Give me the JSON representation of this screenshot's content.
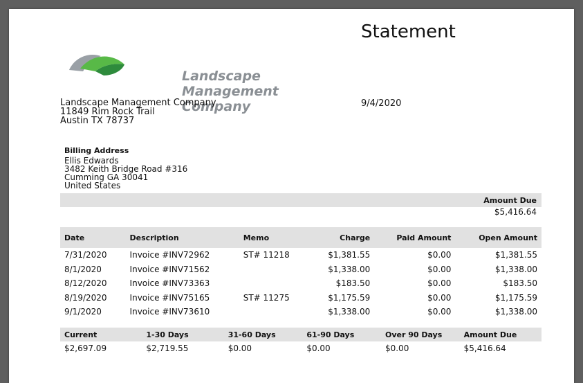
{
  "document": {
    "title": "Statement",
    "logo_text": [
      "Landscape",
      "Management",
      "Company"
    ],
    "company": {
      "name": "Landscape Management Company",
      "street": "11849 Rim Rock Trail",
      "city_line": "Austin TX 78737"
    },
    "date": "9/4/2020",
    "billing": {
      "label": "Billing Address",
      "name": "Ellis Edwards",
      "street": "3482 Keith Bridge Road #316",
      "city_line": "Cumming GA 30041",
      "country": "United States"
    },
    "amount_due_label": "Amount Due",
    "amount_due": "$5,416.64",
    "lines": {
      "headers": [
        "Date",
        "Description",
        "Memo",
        "Charge",
        "Paid Amount",
        "Open Amount"
      ],
      "rows": [
        [
          "7/31/2020",
          "Invoice #INV72962",
          "ST# 11218",
          "$1,381.55",
          "$0.00",
          "$1,381.55"
        ],
        [
          "8/1/2020",
          "Invoice #INV71562",
          "",
          "$1,338.00",
          "$0.00",
          "$1,338.00"
        ],
        [
          "8/12/2020",
          "Invoice #INV73363",
          "",
          "$183.50",
          "$0.00",
          "$183.50"
        ],
        [
          "8/19/2020",
          "Invoice #INV75165",
          "ST# 11275",
          "$1,175.59",
          "$0.00",
          "$1,175.59"
        ],
        [
          "9/1/2020",
          "Invoice #INV73610",
          "",
          "$1,338.00",
          "$0.00",
          "$1,338.00"
        ]
      ]
    },
    "aging": {
      "headers": [
        "Current",
        "1-30 Days",
        "31-60 Days",
        "61-90 Days",
        "Over 90 Days",
        "Amount Due"
      ],
      "values": [
        "$2,697.09",
        "$2,719.55",
        "$0.00",
        "$0.00",
        "$0.00",
        "$5,416.64"
      ]
    },
    "colors": {
      "logo_green": "#58b947",
      "logo_dark_green": "#2e8b3c",
      "header_gray": "#e1e1e1"
    }
  }
}
